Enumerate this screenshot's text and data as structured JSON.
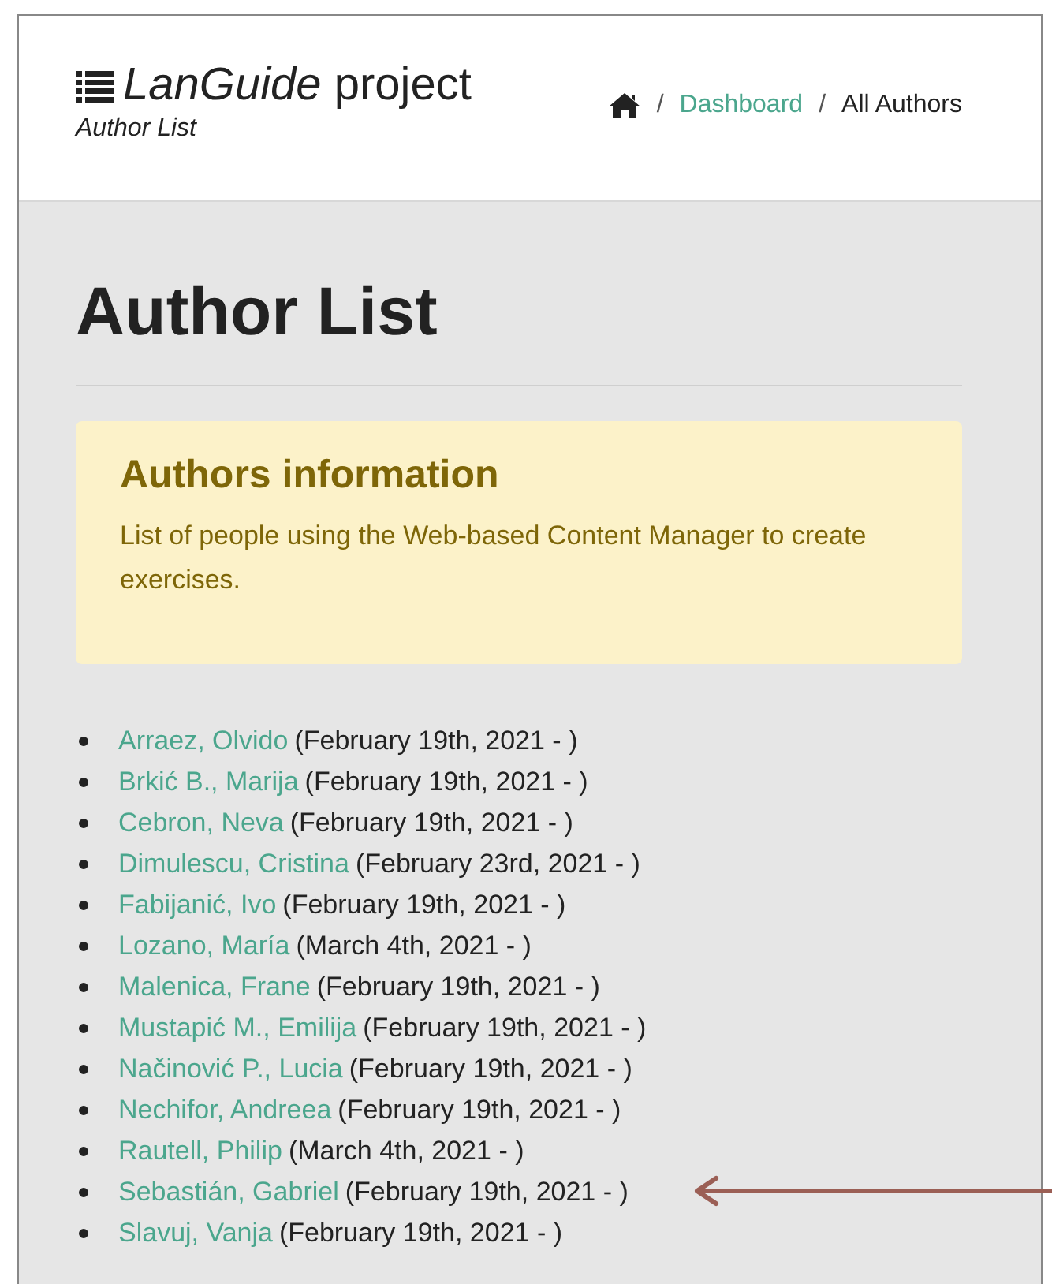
{
  "header": {
    "title": "*LanGuide* project",
    "subtitle": "Author List"
  },
  "breadcrumb": [
    {
      "separator": "/",
      "label": "Dashboard",
      "kind": "link"
    },
    {
      "separator": "/",
      "label": "All Authors",
      "kind": "current"
    }
  ],
  "page_title": "Author List",
  "info_box": {
    "heading": "Authors information",
    "text": "List of people using the Web-based Content Manager to create exercises."
  },
  "authors": [
    {
      "name": "Arraez, Olvido",
      "since": "(February 19th, 2021 - )"
    },
    {
      "name": "Brkić B., Marija",
      "since": "(February 19th, 2021 - )"
    },
    {
      "name": "Cebron, Neva",
      "since": "(February 19th, 2021 - )"
    },
    {
      "name": "Dimulescu, Cristina",
      "since": "(February 23rd, 2021 - )"
    },
    {
      "name": "Fabijanić, Ivo",
      "since": "(February 19th, 2021 - )"
    },
    {
      "name": "Lozano, María",
      "since": "(March 4th, 2021 - )"
    },
    {
      "name": "Malenica, Frane",
      "since": "(February 19th, 2021 - )"
    },
    {
      "name": "Mustapić M., Emilija",
      "since": "(February 19th, 2021 - )"
    },
    {
      "name": "Načinović P., Lucia",
      "since": "(February 19th, 2021 - )"
    },
    {
      "name": "Nechifor, Andreea",
      "since": "(February 19th, 2021 - )"
    },
    {
      "name": "Rautell, Philip",
      "since": "(March 4th, 2021 - )"
    },
    {
      "name": "Sebastián, Gabriel",
      "since": "(February 19th, 2021 - )"
    },
    {
      "name": "Slavuj, Vanja",
      "since": "(February 19th, 2021 - )"
    }
  ]
}
